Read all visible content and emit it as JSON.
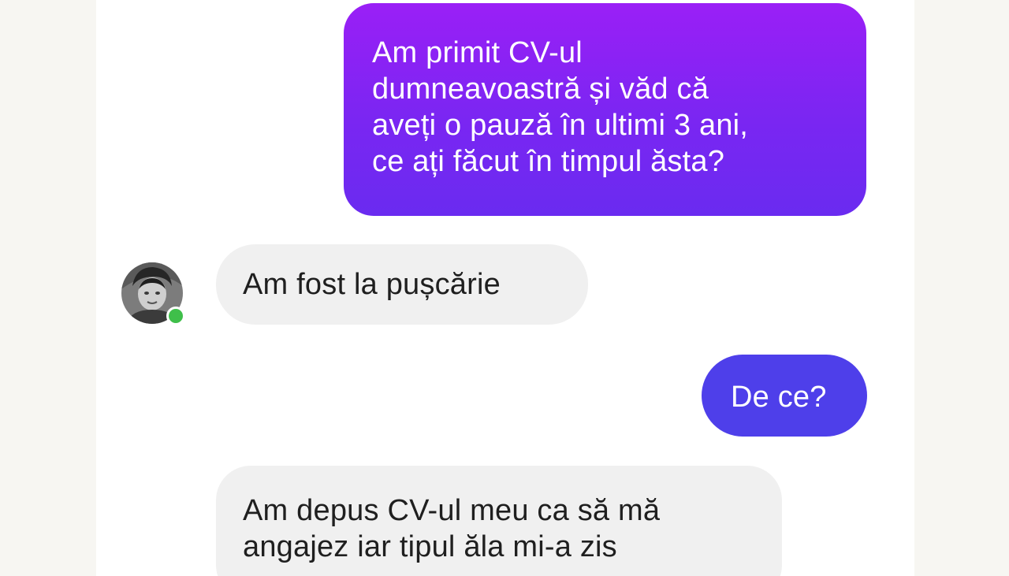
{
  "conversation": {
    "messages": [
      {
        "sender": "self",
        "lines": [
          "Am primit CV-ul",
          "dumneavoastră și văd că",
          "aveți o pauză în ultimi 3 ani,",
          "ce ați făcut în timpul ăsta?"
        ]
      },
      {
        "sender": "contact",
        "lines": [
          "Am fost la pușcărie"
        ]
      },
      {
        "sender": "self",
        "lines": [
          "De ce?"
        ]
      },
      {
        "sender": "contact",
        "lines": [
          "Am depus CV-ul meu ca să mă",
          "angajez iar tipul ăla mi-a zis"
        ]
      }
    ]
  },
  "contact": {
    "avatar_icon": "user-photo-avatar",
    "status": "online",
    "status_color": "#3fbf4a"
  },
  "colors": {
    "sent_bubble_gradient": [
      "#9a1ff6",
      "#6a2bf0"
    ],
    "sent_bubble_short": "#4e3fea",
    "received_bubble": "#f0f0f0"
  }
}
